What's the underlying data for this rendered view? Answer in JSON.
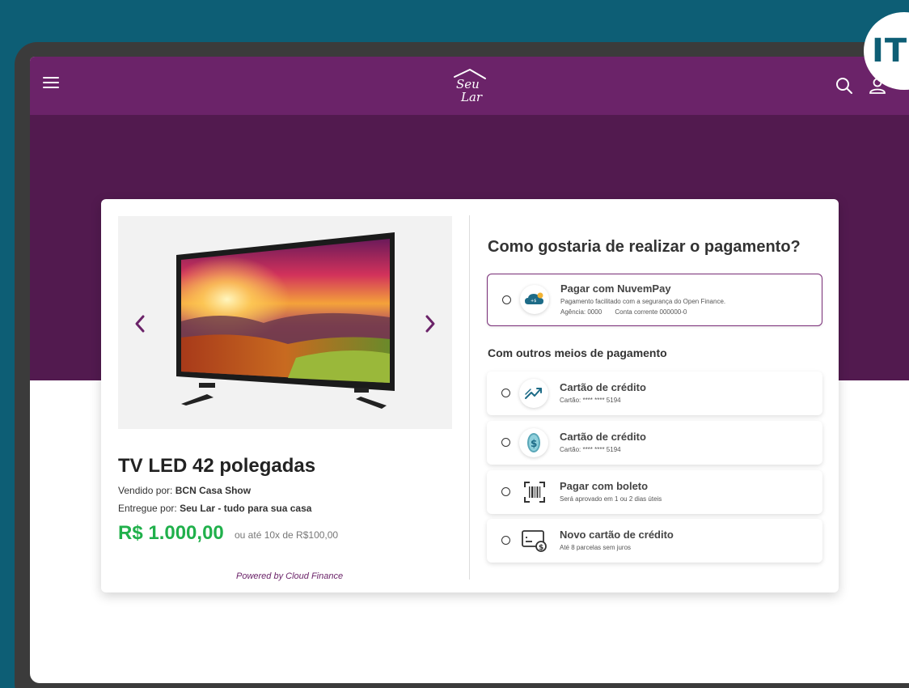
{
  "corner_badge": "ITI",
  "header": {
    "logo_line1": "Seu",
    "logo_line2": "Lar"
  },
  "product": {
    "title": "TV LED 42 polegadas",
    "sold_by_label": "Vendido por:",
    "sold_by": "BCN Casa Show",
    "delivered_by_label": "Entregue por:",
    "delivered_by": "Seu Lar - tudo para sua casa",
    "price": "R$ 1.000,00",
    "installments": "ou até 10x de R$100,00",
    "powered_by": "Powered by Cloud Finance"
  },
  "payment": {
    "title": "Como gostaria de realizar o pagamento?",
    "primary": {
      "title": "Pagar com NuvemPay",
      "subtitle": "Pagamento facilitado com a segurança do Open Finance.",
      "agency": "Agência: 0000",
      "account": "Conta corrente 000000-0",
      "icon": "cloud-icon"
    },
    "others_title": "Com outros meios de pagamento",
    "options": [
      {
        "title": "Cartão de crédito",
        "subtitle": "Cartão: **** **** 5194",
        "icon": "trend-up-icon"
      },
      {
        "title": "Cartão de crédito",
        "subtitle": "Cartão: **** **** 5194",
        "icon": "coin-icon"
      },
      {
        "title": "Pagar com boleto",
        "subtitle": "Será aprovado em 1 ou 2 dias úteis",
        "icon": "barcode-icon"
      },
      {
        "title": "Novo cartão de crédito",
        "subtitle": "Até 8 parcelas sem juros",
        "icon": "card-money-icon"
      }
    ]
  },
  "colors": {
    "background": "#0d5e75",
    "header": "#6b2369",
    "hero": "#521a4f",
    "price": "#20b04b",
    "accent": "#6b2369"
  }
}
